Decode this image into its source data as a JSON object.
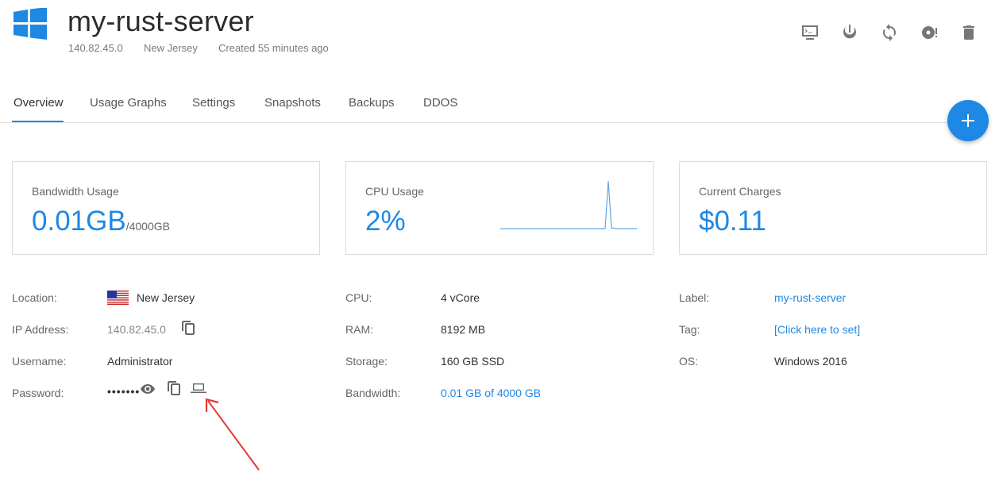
{
  "header": {
    "title": "my-rust-server",
    "ip": "140.82.45.0",
    "location": "New Jersey",
    "created": "Created 55 minutes ago",
    "os_icon": "windows-logo-icon",
    "actions": [
      "console-icon",
      "power-icon",
      "restart-icon",
      "reinstall-icon",
      "trash-icon"
    ]
  },
  "tabs": [
    {
      "label": "Overview",
      "active": true
    },
    {
      "label": "Usage Graphs"
    },
    {
      "label": "Settings"
    },
    {
      "label": "Snapshots"
    },
    {
      "label": "Backups"
    },
    {
      "label": "DDOS"
    }
  ],
  "fab_icon": "plus-icon",
  "cards": {
    "bandwidth": {
      "label": "Bandwidth Usage",
      "value": "0.01GB",
      "unit": "/4000GB"
    },
    "cpu": {
      "label": "CPU Usage",
      "value": "2%"
    },
    "charges": {
      "label": "Current Charges",
      "value": "$0.11"
    }
  },
  "details": {
    "location_label": "Location:",
    "location_value": "New Jersey",
    "ip_label": "IP Address:",
    "ip_value": "140.82.45.0",
    "username_label": "Username:",
    "username_value": "Administrator",
    "password_label": "Password:",
    "password_value": "•••••••",
    "cpu_label": "CPU:",
    "cpu_value": "4 vCore",
    "ram_label": "RAM:",
    "ram_value": "8192 MB",
    "storage_label": "Storage:",
    "storage_value": "160 GB SSD",
    "bandwidth_label": "Bandwidth:",
    "bandwidth_value": "0.01 GB of 4000 GB",
    "label_label": "Label:",
    "label_value": "my-rust-server",
    "tag_label": "Tag:",
    "tag_value": "[Click here to set]",
    "os_label": "OS:",
    "os_value": "Windows 2016"
  },
  "colors": {
    "accent": "#1e88e5",
    "annotation_arrow": "#e53935"
  }
}
